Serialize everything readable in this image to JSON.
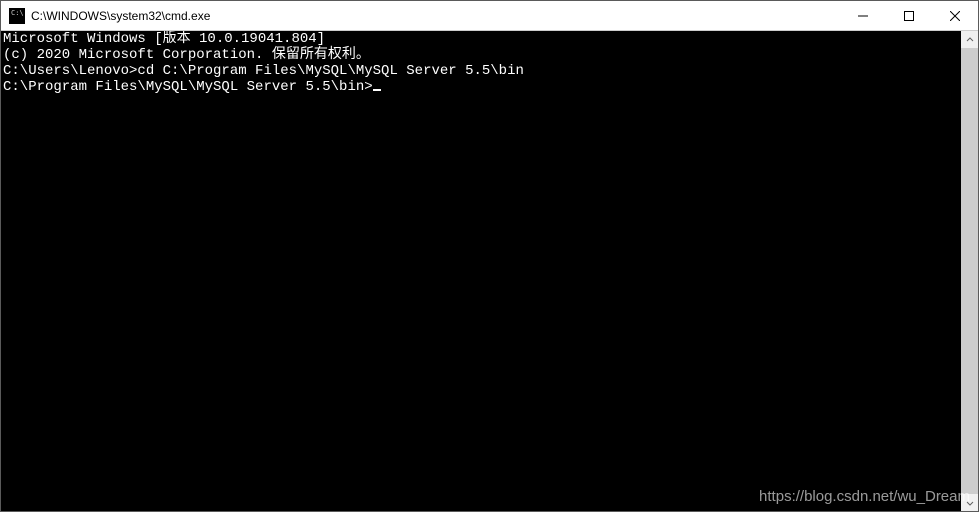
{
  "window": {
    "title": "C:\\WINDOWS\\system32\\cmd.exe"
  },
  "terminal": {
    "lines": [
      "Microsoft Windows [版本 10.0.19041.804]",
      "(c) 2020 Microsoft Corporation. 保留所有权利。",
      "",
      "C:\\Users\\Lenovo>cd C:\\Program Files\\MySQL\\MySQL Server 5.5\\bin",
      "",
      "C:\\Program Files\\MySQL\\MySQL Server 5.5\\bin>"
    ],
    "cursor_after_last": true
  },
  "watermark": "https://blog.csdn.net/wu_Dream"
}
